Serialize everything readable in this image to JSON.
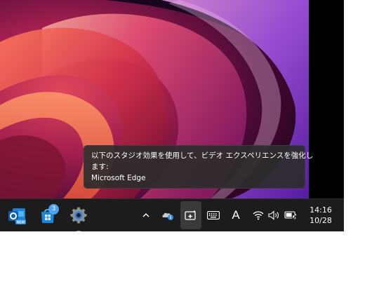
{
  "tooltip": {
    "line1": "以下のスタジオ効果を使用して、ビデオ エクスペリエンスを強化し",
    "line2": "ます:",
    "line3": "Microsoft Edge"
  },
  "taskbar": {
    "apps": [
      {
        "name": "Outlook (new)",
        "icon": "outlook-icon",
        "badge_text": "NEW"
      },
      {
        "name": "Microsoft Store",
        "icon": "store-icon",
        "notification_count": "3"
      },
      {
        "name": "Settings",
        "icon": "settings-gear-icon",
        "running": true
      }
    ],
    "tray": {
      "icons": [
        "chevron-up-icon",
        "onedrive-cloud-icon",
        "studio-effects-icon",
        "keyboard-icon",
        "ime-icon",
        "wifi-icon",
        "volume-icon",
        "battery-charging-icon"
      ],
      "ime_label": "A"
    },
    "clock": {
      "time": "14:16",
      "date": "10/28"
    }
  },
  "colors": {
    "accent": "#4ca3f5",
    "taskbar": "#1c1c1c",
    "running_indicator": "#9a9a9a"
  }
}
